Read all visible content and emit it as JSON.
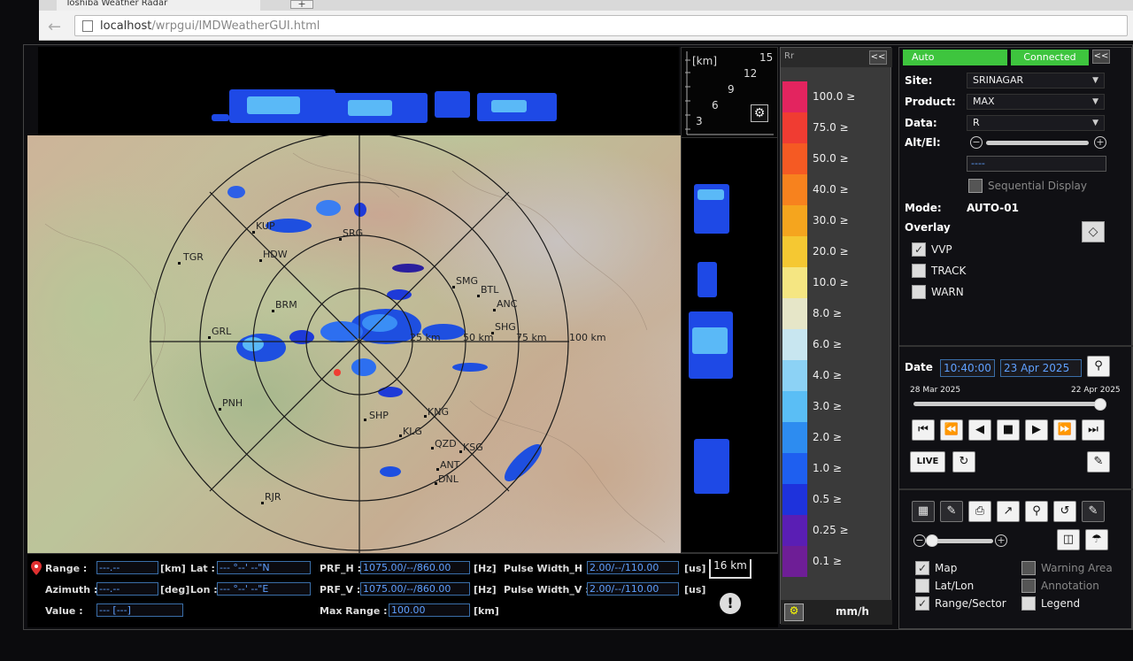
{
  "browser": {
    "tab_title": "Toshiba Weather Radar",
    "new_tab": "+",
    "url_host": "localhost",
    "url_path": "/wrpgui/IMDWeatherGUI.html"
  },
  "height_axis": {
    "unit": "[km]",
    "ticks": [
      "15",
      "12",
      "9",
      "6",
      "3"
    ]
  },
  "map": {
    "range_labels": [
      "25 km",
      "50 km",
      "75 km",
      "100 km"
    ],
    "sites": [
      "TGR",
      "KUP",
      "HDW",
      "BRM",
      "GRL",
      "PNH",
      "RJR",
      "SRG",
      "SMG",
      "BTL",
      "ANC",
      "SHG",
      "SHP",
      "KNG",
      "KLG",
      "QZD",
      "KSG",
      "DNL",
      "ANT"
    ]
  },
  "colorbar": {
    "product": "Rr",
    "collapse": "<<",
    "labels": [
      "100.0 ≥",
      "75.0 ≥",
      "50.0 ≥",
      "40.0 ≥",
      "30.0 ≥",
      "20.0 ≥",
      "10.0 ≥",
      "8.0 ≥",
      "6.0 ≥",
      "4.0 ≥",
      "3.0 ≥",
      "2.0 ≥",
      "1.0 ≥",
      "0.5 ≥",
      "0.25 ≥",
      "0.1 ≥"
    ],
    "colors": [
      "#e3245f",
      "#f03c32",
      "#f55a23",
      "#f7821e",
      "#f5a51e",
      "#f5c832",
      "#f5e682",
      "#e6e6c8",
      "#c8e6f0",
      "#8cd2f5",
      "#5abef5",
      "#2d8cf0",
      "#1e5ff0",
      "#1e32dc",
      "#5a1eb4",
      "#6e1e96"
    ],
    "unit": "mm/h"
  },
  "info": {
    "range_label": "Range :",
    "range_value": "---.--",
    "range_unit": "[km]",
    "lat_label": "Lat :",
    "lat_value": "--- °--' --\"N",
    "azimuth_label": "Azimuth :",
    "azimuth_value": "---.--",
    "azimuth_unit": "[deg]",
    "lon_label": "Lon :",
    "lon_value": "--- °--' --\"E",
    "value_label": "Value :",
    "value_value": "--- [---]",
    "prf_h_label": "PRF_H :",
    "prf_h_value": "1075.00/--/860.00",
    "prf_v_label": "PRF_V :",
    "prf_v_value": "1075.00/--/860.00",
    "hz": "[Hz]",
    "pw_h_label": "Pulse Width_H :",
    "pw_h_value": "2.00/--/110.00",
    "pw_v_label": "Pulse Width_V :",
    "pw_v_value": "2.00/--/110.00",
    "us": "[us]",
    "max_range_label": "Max Range :",
    "max_range_value": "100.00",
    "max_range_unit": "[km]",
    "scale": "16 km"
  },
  "control": {
    "auto": "Auto",
    "connected": "Connected",
    "collapse": "<<",
    "site_label": "Site:",
    "site_value": "SRINAGAR",
    "product_label": "Product:",
    "product_value": "MAX",
    "data_label": "Data:",
    "data_value": "R",
    "alt_label": "Alt/El:",
    "alt_value": "----",
    "sequential": "Sequential Display",
    "mode_label": "Mode:",
    "mode_value": "AUTO-01",
    "overlay_label": "Overlay",
    "overlay_items": [
      "VVP",
      "TRACK",
      "WARN"
    ],
    "date_label": "Date",
    "time_value": "10:40:00",
    "date_value": "23 Apr 2025",
    "range_start": "28 Mar 2025",
    "range_end": "22 Apr 2025",
    "live": "LIVE",
    "layer_items_left": [
      "Map",
      "Lat/Lon",
      "Range/Sector"
    ],
    "layer_items_right": [
      "Warning Area",
      "Annotation",
      "Legend"
    ]
  }
}
